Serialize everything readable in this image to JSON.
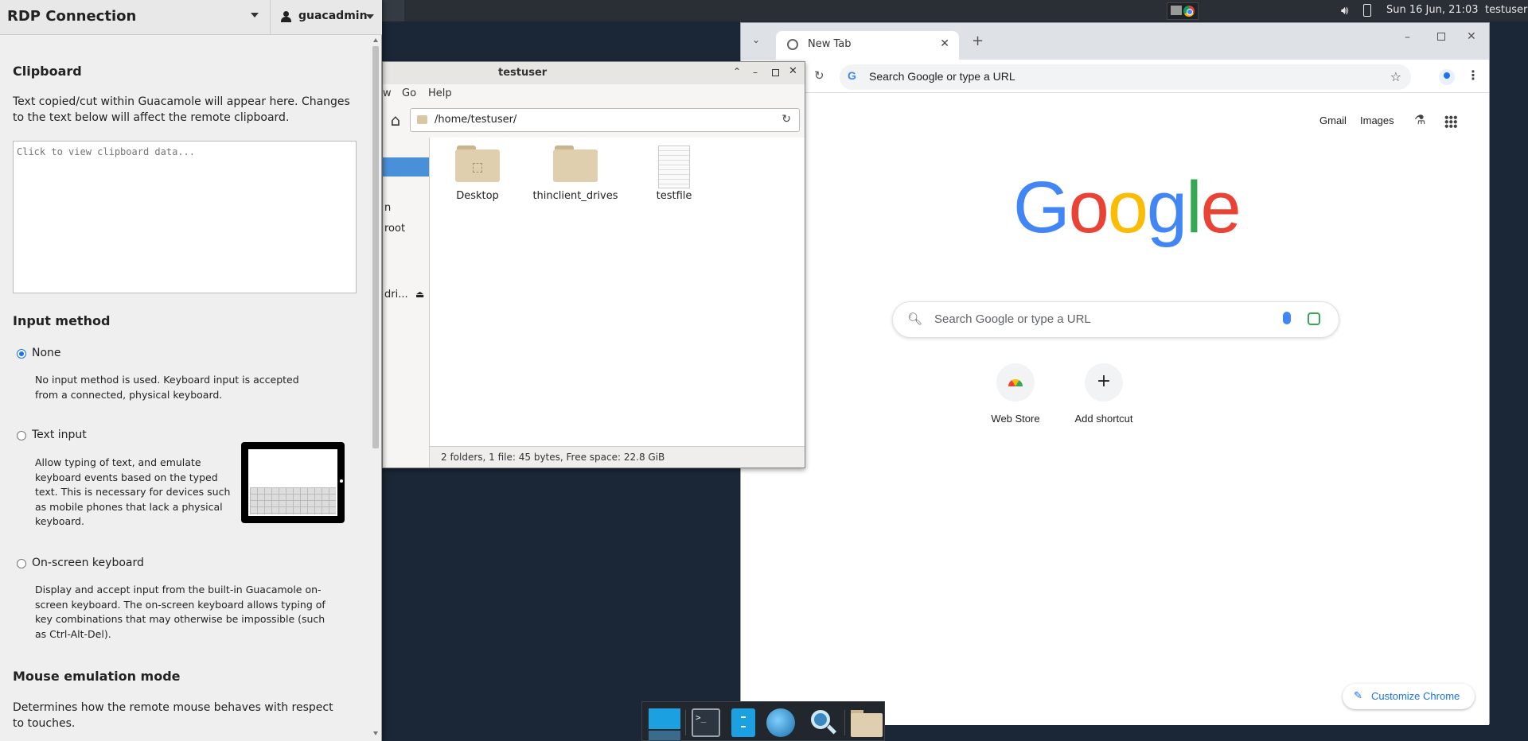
{
  "guac": {
    "connection_title": "RDP Connection",
    "username": "guacadmin",
    "clipboard": {
      "heading": "Clipboard",
      "description": "Text copied/cut within Guacamole will appear here. Changes to the text below will affect the remote clipboard.",
      "placeholder": "Click to view clipboard data..."
    },
    "input_method": {
      "heading": "Input method",
      "options": [
        {
          "label": "None",
          "selected": true,
          "description": "No input method is used. Keyboard input is accepted from a connected, physical keyboard."
        },
        {
          "label": "Text input",
          "selected": false,
          "description": "Allow typing of text, and emulate keyboard events based on the typed text. This is necessary for devices such as mobile phones that lack a physical keyboard."
        },
        {
          "label": "On-screen keyboard",
          "selected": false,
          "description": "Display and accept input from the built-in Guacamole on-screen keyboard. The on-screen keyboard allows typing of key combinations that may otherwise be impossible (such as Ctrl-Alt-Del)."
        }
      ]
    },
    "mouse_emulation": {
      "heading": "Mouse emulation mode",
      "description": "Determines how the remote mouse behaves with respect to touches."
    }
  },
  "top_panel": {
    "clock": "Sun 16 Jun, 21:03",
    "user": "testuser"
  },
  "file_manager": {
    "title": "testuser",
    "menus": [
      "w",
      "Go",
      "Help"
    ],
    "path": "/home/testuser/",
    "sidebar_items": [
      "n",
      "root",
      "dri..."
    ],
    "files": [
      {
        "name": "Desktop",
        "type": "folder"
      },
      {
        "name": "thinclient_drives",
        "type": "folder"
      },
      {
        "name": "testfile",
        "type": "file"
      }
    ],
    "status": "2 folders, 1 file: 45 bytes, Free space: 22.8 GiB"
  },
  "chrome": {
    "tab_title": "New Tab",
    "omnibox_text": "Search Google or type a URL",
    "links": [
      "Gmail",
      "Images"
    ],
    "logo_letters": [
      "G",
      "o",
      "o",
      "g",
      "l",
      "e"
    ],
    "search_placeholder": "Search Google or type a URL",
    "shortcuts": [
      {
        "label": "Web Store"
      },
      {
        "label": "Add shortcut",
        "icon": "+"
      }
    ],
    "customize_label": "Customize Chrome"
  },
  "dock": {
    "terminal_glyph": ">_"
  },
  "colors": {
    "desktop_bg": "#1b2636",
    "selection_blue": "#4a90d9",
    "chrome_blue": "#1a73e8"
  }
}
